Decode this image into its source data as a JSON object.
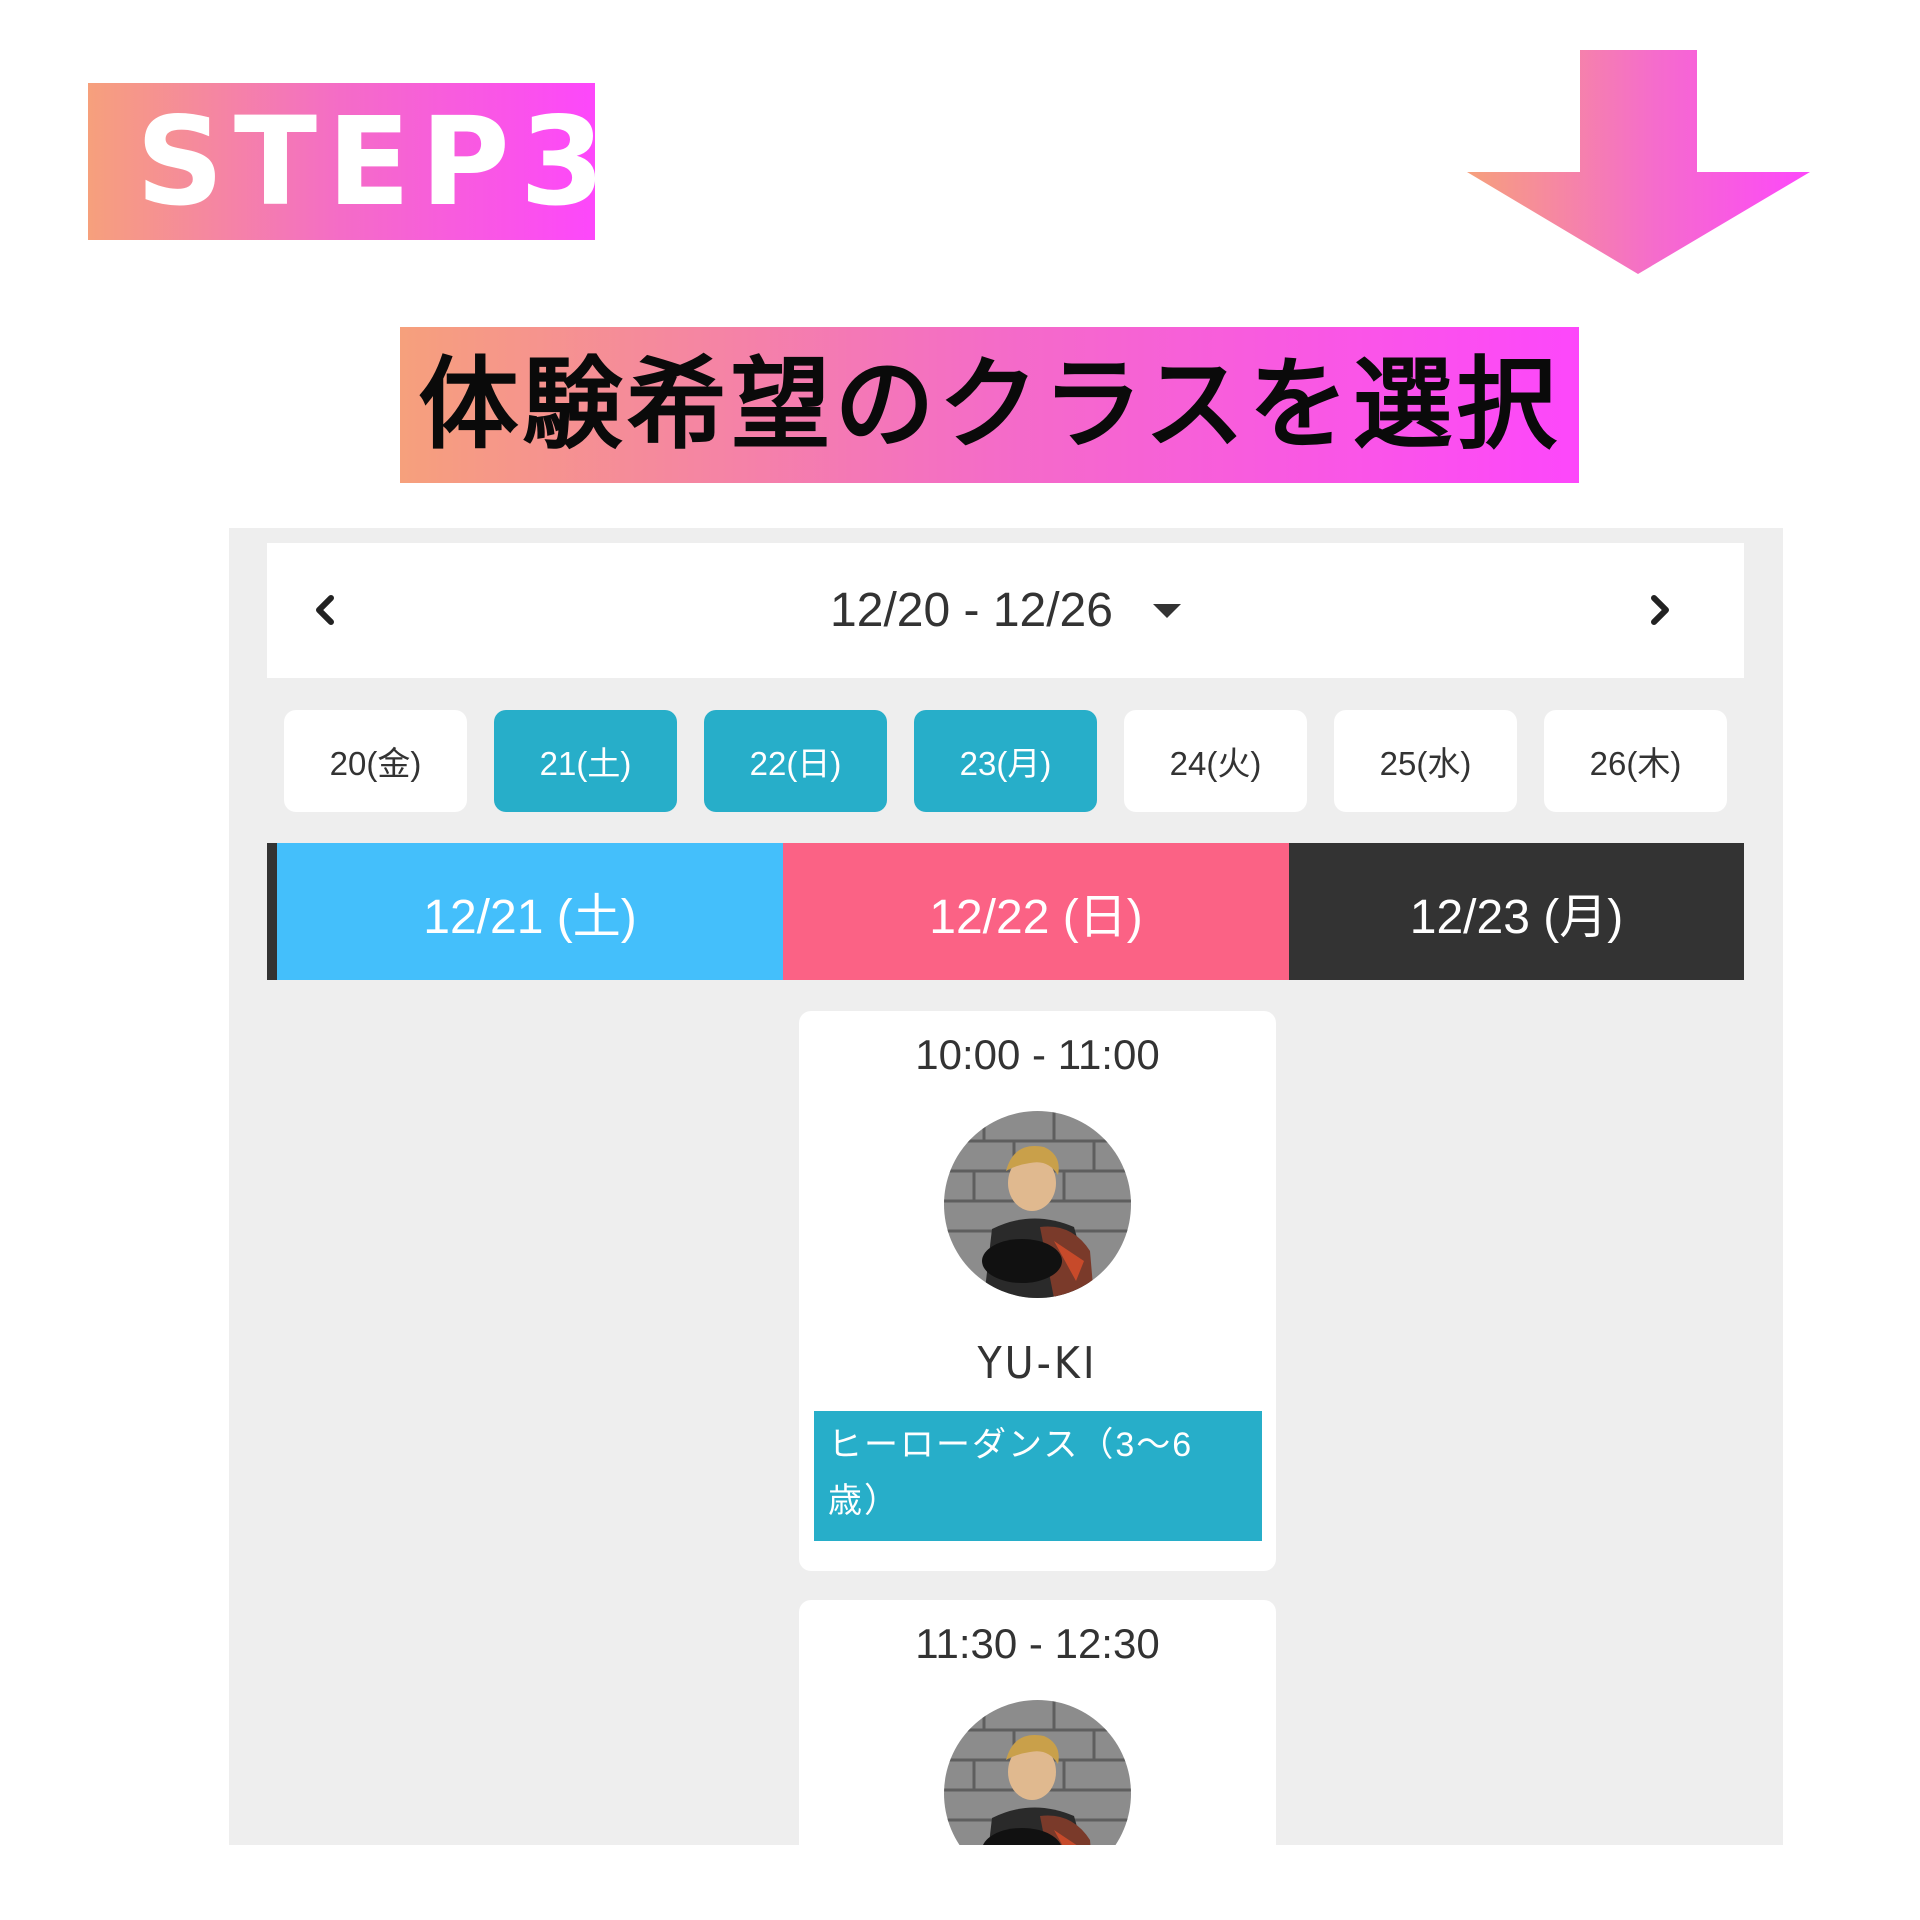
{
  "step": {
    "label": "STEP3"
  },
  "heading": {
    "text": "体験希望のクラスを選択"
  },
  "week_nav": {
    "range": "12/20 - 12/26"
  },
  "days": [
    {
      "label": "20(金)",
      "active": false
    },
    {
      "label": "21(土)",
      "active": true
    },
    {
      "label": "22(日)",
      "active": true
    },
    {
      "label": "23(月)",
      "active": true
    },
    {
      "label": "24(火)",
      "active": false
    },
    {
      "label": "25(水)",
      "active": false
    },
    {
      "label": "26(木)",
      "active": false
    }
  ],
  "date_headers": [
    {
      "label": "12/21 (土)",
      "color": "#44bffb"
    },
    {
      "label": "12/22 (日)",
      "color": "#fb6285"
    },
    {
      "label": "12/23 (月)",
      "color": "#333333"
    }
  ],
  "classes": [
    {
      "time": "10:00 - 11:00",
      "instructor": "YU-KI",
      "title": "ヒーローダンス（3〜6歳）"
    },
    {
      "time": "11:30 - 12:30"
    }
  ],
  "colors": {
    "gradient_start": "#f6a07c",
    "gradient_end": "#fd47fb",
    "accent": "#27aec9"
  }
}
